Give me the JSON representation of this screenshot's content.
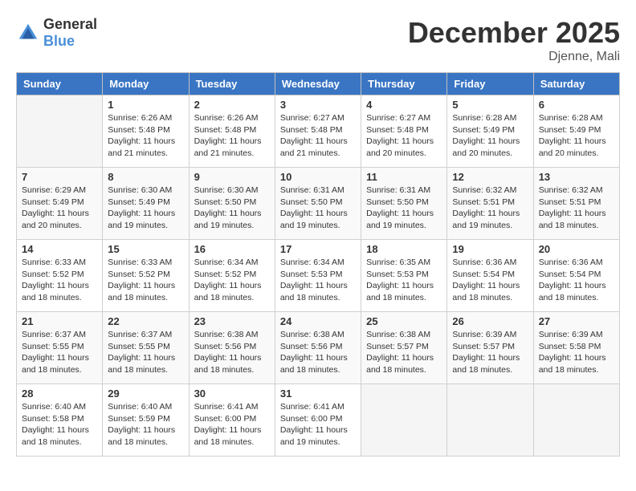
{
  "header": {
    "logo_general": "General",
    "logo_blue": "Blue",
    "month_title": "December 2025",
    "location": "Djenne, Mali"
  },
  "weekdays": [
    "Sunday",
    "Monday",
    "Tuesday",
    "Wednesday",
    "Thursday",
    "Friday",
    "Saturday"
  ],
  "weeks": [
    [
      {
        "day": "",
        "info": ""
      },
      {
        "day": "1",
        "info": "Sunrise: 6:26 AM\nSunset: 5:48 PM\nDaylight: 11 hours\nand 21 minutes."
      },
      {
        "day": "2",
        "info": "Sunrise: 6:26 AM\nSunset: 5:48 PM\nDaylight: 11 hours\nand 21 minutes."
      },
      {
        "day": "3",
        "info": "Sunrise: 6:27 AM\nSunset: 5:48 PM\nDaylight: 11 hours\nand 21 minutes."
      },
      {
        "day": "4",
        "info": "Sunrise: 6:27 AM\nSunset: 5:48 PM\nDaylight: 11 hours\nand 20 minutes."
      },
      {
        "day": "5",
        "info": "Sunrise: 6:28 AM\nSunset: 5:49 PM\nDaylight: 11 hours\nand 20 minutes."
      },
      {
        "day": "6",
        "info": "Sunrise: 6:28 AM\nSunset: 5:49 PM\nDaylight: 11 hours\nand 20 minutes."
      }
    ],
    [
      {
        "day": "7",
        "info": "Sunrise: 6:29 AM\nSunset: 5:49 PM\nDaylight: 11 hours\nand 20 minutes."
      },
      {
        "day": "8",
        "info": "Sunrise: 6:30 AM\nSunset: 5:49 PM\nDaylight: 11 hours\nand 19 minutes."
      },
      {
        "day": "9",
        "info": "Sunrise: 6:30 AM\nSunset: 5:50 PM\nDaylight: 11 hours\nand 19 minutes."
      },
      {
        "day": "10",
        "info": "Sunrise: 6:31 AM\nSunset: 5:50 PM\nDaylight: 11 hours\nand 19 minutes."
      },
      {
        "day": "11",
        "info": "Sunrise: 6:31 AM\nSunset: 5:50 PM\nDaylight: 11 hours\nand 19 minutes."
      },
      {
        "day": "12",
        "info": "Sunrise: 6:32 AM\nSunset: 5:51 PM\nDaylight: 11 hours\nand 19 minutes."
      },
      {
        "day": "13",
        "info": "Sunrise: 6:32 AM\nSunset: 5:51 PM\nDaylight: 11 hours\nand 18 minutes."
      }
    ],
    [
      {
        "day": "14",
        "info": "Sunrise: 6:33 AM\nSunset: 5:52 PM\nDaylight: 11 hours\nand 18 minutes."
      },
      {
        "day": "15",
        "info": "Sunrise: 6:33 AM\nSunset: 5:52 PM\nDaylight: 11 hours\nand 18 minutes."
      },
      {
        "day": "16",
        "info": "Sunrise: 6:34 AM\nSunset: 5:52 PM\nDaylight: 11 hours\nand 18 minutes."
      },
      {
        "day": "17",
        "info": "Sunrise: 6:34 AM\nSunset: 5:53 PM\nDaylight: 11 hours\nand 18 minutes."
      },
      {
        "day": "18",
        "info": "Sunrise: 6:35 AM\nSunset: 5:53 PM\nDaylight: 11 hours\nand 18 minutes."
      },
      {
        "day": "19",
        "info": "Sunrise: 6:36 AM\nSunset: 5:54 PM\nDaylight: 11 hours\nand 18 minutes."
      },
      {
        "day": "20",
        "info": "Sunrise: 6:36 AM\nSunset: 5:54 PM\nDaylight: 11 hours\nand 18 minutes."
      }
    ],
    [
      {
        "day": "21",
        "info": "Sunrise: 6:37 AM\nSunset: 5:55 PM\nDaylight: 11 hours\nand 18 minutes."
      },
      {
        "day": "22",
        "info": "Sunrise: 6:37 AM\nSunset: 5:55 PM\nDaylight: 11 hours\nand 18 minutes."
      },
      {
        "day": "23",
        "info": "Sunrise: 6:38 AM\nSunset: 5:56 PM\nDaylight: 11 hours\nand 18 minutes."
      },
      {
        "day": "24",
        "info": "Sunrise: 6:38 AM\nSunset: 5:56 PM\nDaylight: 11 hours\nand 18 minutes."
      },
      {
        "day": "25",
        "info": "Sunrise: 6:38 AM\nSunset: 5:57 PM\nDaylight: 11 hours\nand 18 minutes."
      },
      {
        "day": "26",
        "info": "Sunrise: 6:39 AM\nSunset: 5:57 PM\nDaylight: 11 hours\nand 18 minutes."
      },
      {
        "day": "27",
        "info": "Sunrise: 6:39 AM\nSunset: 5:58 PM\nDaylight: 11 hours\nand 18 minutes."
      }
    ],
    [
      {
        "day": "28",
        "info": "Sunrise: 6:40 AM\nSunset: 5:58 PM\nDaylight: 11 hours\nand 18 minutes."
      },
      {
        "day": "29",
        "info": "Sunrise: 6:40 AM\nSunset: 5:59 PM\nDaylight: 11 hours\nand 18 minutes."
      },
      {
        "day": "30",
        "info": "Sunrise: 6:41 AM\nSunset: 6:00 PM\nDaylight: 11 hours\nand 18 minutes."
      },
      {
        "day": "31",
        "info": "Sunrise: 6:41 AM\nSunset: 6:00 PM\nDaylight: 11 hours\nand 19 minutes."
      },
      {
        "day": "",
        "info": ""
      },
      {
        "day": "",
        "info": ""
      },
      {
        "day": "",
        "info": ""
      }
    ]
  ]
}
